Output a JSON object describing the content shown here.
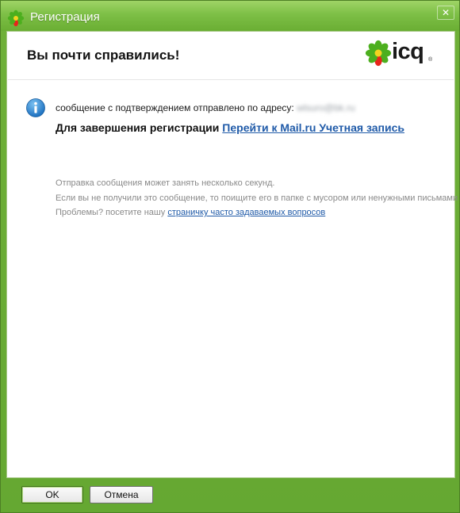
{
  "window": {
    "title": "Регистрация"
  },
  "header": {
    "heading": "Вы почти справились!",
    "logo_text": "icq",
    "logo_tm": "®"
  },
  "message": {
    "sent_text": "сообщение с подтверждением отправлено по адресу:",
    "email": "wlsuro@bk.ru",
    "finish_prefix": "Для завершения регистрации",
    "finish_link": "Перейти к Mail.ru Учетная запись"
  },
  "notes": {
    "line1": "Отправка сообщения может занять несколько секунд.",
    "line2": "Если вы не получили это сообщение, то поищите его в папке с мусором или ненужными письмами",
    "line3_prefix": "Проблемы? посетите нашу",
    "faq_link": "страничку часто задаваемых вопросов"
  },
  "buttons": {
    "ok": "OK",
    "cancel": "Отмена"
  },
  "colors": {
    "titlebar": "#7dbf46",
    "link": "#1f5aa8",
    "info_icon": "#2a86d1"
  }
}
